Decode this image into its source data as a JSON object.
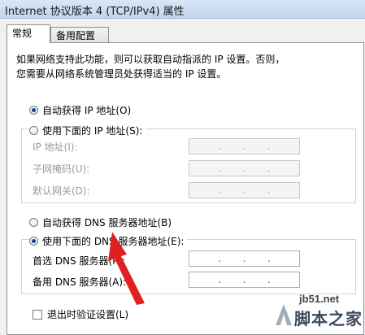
{
  "window": {
    "title": "Internet 协议版本 4 (TCP/IPv4) 属性"
  },
  "tabs": [
    {
      "label": "常规",
      "active": true
    },
    {
      "label": "备用配置",
      "active": false
    }
  ],
  "description": {
    "line1": "如果网络支持此功能，则可以获取自动指派的 IP 设置。否则，",
    "line2": "您需要从网络系统管理员处获得适当的 IP 设置。"
  },
  "ip_section": {
    "auto_label": "自动获得 IP 地址(O)",
    "auto_selected": true,
    "manual_label": "使用下面的 IP 地址(S):",
    "manual_selected": false,
    "fields": [
      {
        "label": "IP 地址(I):",
        "value": ". . ."
      },
      {
        "label": "子网掩码(U):",
        "value": ". . ."
      },
      {
        "label": "默认网关(D):",
        "value": ". . ."
      }
    ]
  },
  "dns_section": {
    "auto_label": "自动获得 DNS 服务器地址(B)",
    "auto_selected": false,
    "manual_label": "使用下面的 DNS 服务器地址(E):",
    "manual_selected": true,
    "fields": [
      {
        "label": "首选 DNS 服务器(P):",
        "value": ". . ."
      },
      {
        "label": "备用 DNS 服务器(A):",
        "value": ". . ."
      }
    ]
  },
  "validate_on_exit": {
    "label": "退出时验证设置(L)",
    "checked": false
  },
  "watermark": {
    "domain": "jb51.net",
    "brand": "脚本之家"
  },
  "colors": {
    "annotation_arrow": "#e02020",
    "radio_dot": "#1b3f88"
  }
}
